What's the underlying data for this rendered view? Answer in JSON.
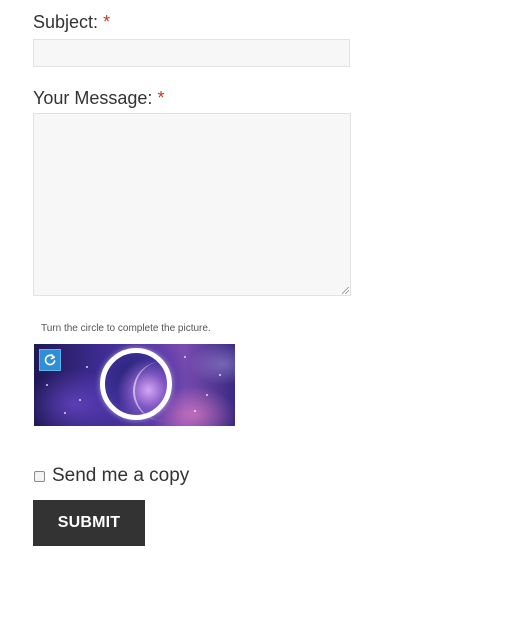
{
  "form": {
    "subject": {
      "label": "Subject:",
      "required_mark": "*",
      "value": "",
      "placeholder": ""
    },
    "message": {
      "label": "Your Message:",
      "required_mark": "*",
      "value": "",
      "placeholder": ""
    },
    "captcha": {
      "hint": "Turn the circle to complete the picture.",
      "refresh_icon": "rotate-icon"
    },
    "copy": {
      "label": "Send me a copy",
      "checked": false
    },
    "submit_label": "SUBMIT"
  },
  "colors": {
    "required": "#c0392b",
    "submit_bg": "#333333",
    "refresh_bg": "#2e8fd6",
    "field_bg": "#f7f7f7"
  }
}
